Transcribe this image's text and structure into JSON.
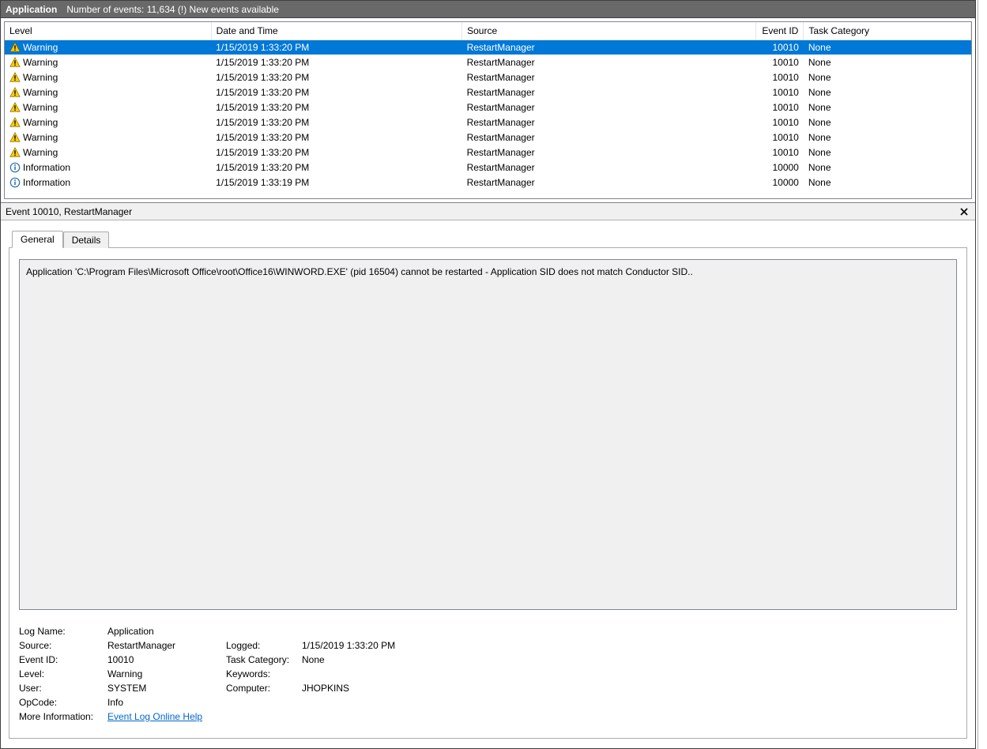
{
  "header": {
    "app_label": "Application",
    "events_text": "Number of events: 11,634 (!) New events available"
  },
  "columns": {
    "level": "Level",
    "date": "Date and Time",
    "source": "Source",
    "eventid": "Event ID",
    "task": "Task Category"
  },
  "events": [
    {
      "level": "Warning",
      "icon": "warning",
      "date": "1/15/2019 1:33:20 PM",
      "source": "RestartManager",
      "eventid": "10010",
      "task": "None",
      "selected": true
    },
    {
      "level": "Warning",
      "icon": "warning",
      "date": "1/15/2019 1:33:20 PM",
      "source": "RestartManager",
      "eventid": "10010",
      "task": "None"
    },
    {
      "level": "Warning",
      "icon": "warning",
      "date": "1/15/2019 1:33:20 PM",
      "source": "RestartManager",
      "eventid": "10010",
      "task": "None"
    },
    {
      "level": "Warning",
      "icon": "warning",
      "date": "1/15/2019 1:33:20 PM",
      "source": "RestartManager",
      "eventid": "10010",
      "task": "None"
    },
    {
      "level": "Warning",
      "icon": "warning",
      "date": "1/15/2019 1:33:20 PM",
      "source": "RestartManager",
      "eventid": "10010",
      "task": "None"
    },
    {
      "level": "Warning",
      "icon": "warning",
      "date": "1/15/2019 1:33:20 PM",
      "source": "RestartManager",
      "eventid": "10010",
      "task": "None"
    },
    {
      "level": "Warning",
      "icon": "warning",
      "date": "1/15/2019 1:33:20 PM",
      "source": "RestartManager",
      "eventid": "10010",
      "task": "None"
    },
    {
      "level": "Warning",
      "icon": "warning",
      "date": "1/15/2019 1:33:20 PM",
      "source": "RestartManager",
      "eventid": "10010",
      "task": "None"
    },
    {
      "level": "Information",
      "icon": "info",
      "date": "1/15/2019 1:33:20 PM",
      "source": "RestartManager",
      "eventid": "10000",
      "task": "None"
    },
    {
      "level": "Information",
      "icon": "info",
      "date": "1/15/2019 1:33:19 PM",
      "source": "RestartManager",
      "eventid": "10000",
      "task": "None"
    }
  ],
  "detail": {
    "title": "Event 10010, RestartManager",
    "tabs": {
      "general": "General",
      "details": "Details"
    },
    "description": "Application 'C:\\Program Files\\Microsoft Office\\root\\Office16\\WINWORD.EXE' (pid 16504) cannot be restarted - Application SID does not match Conductor SID..",
    "meta": {
      "log_name_label": "Log Name:",
      "log_name": "Application",
      "source_label": "Source:",
      "source": "RestartManager",
      "logged_label": "Logged:",
      "logged": "1/15/2019 1:33:20 PM",
      "eventid_label": "Event ID:",
      "eventid": "10010",
      "taskcat_label": "Task Category:",
      "taskcat": "None",
      "level_label": "Level:",
      "level": "Warning",
      "keywords_label": "Keywords:",
      "keywords": "",
      "user_label": "User:",
      "user": "SYSTEM",
      "computer_label": "Computer:",
      "computer": "JHOPKINS",
      "opcode_label": "OpCode:",
      "opcode": "Info",
      "moreinfo_label": "More Information:",
      "moreinfo_link": "Event Log Online Help"
    }
  }
}
